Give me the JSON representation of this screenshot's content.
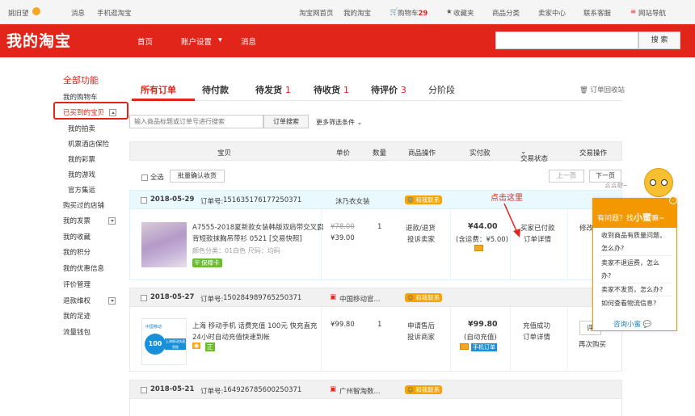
{
  "topbar": {
    "user": "姚旧望",
    "messages": "消息",
    "mobile": "手机逛淘宝",
    "home": "淘宝网首页",
    "mytaobao": "我的淘宝",
    "cart": "购物车",
    "cart_count": "29",
    "fav": "收藏夹",
    "category": "商品分类",
    "seller": "卖家中心",
    "service": "联系客服",
    "sitenav": "网站导航"
  },
  "header": {
    "logo": "我的淘宝",
    "nav": [
      "首页",
      "账户设置",
      "消息"
    ],
    "search_button": "搜 索"
  },
  "sidebar": {
    "title": "全部功能",
    "items": [
      "我的购物车",
      "已买到的宝贝",
      "我的拍卖",
      "机票酒店保险",
      "我的彩票",
      "我的游戏",
      "官方集运",
      "购买过的店铺",
      "我的发票",
      "我的收藏",
      "我的积分",
      "我的优惠信息",
      "评价管理",
      "退款维权",
      "我的足迹",
      "流量钱包"
    ]
  },
  "tabs": [
    {
      "label": "所有订单",
      "count": ""
    },
    {
      "label": "待付款",
      "count": ""
    },
    {
      "label": "待发货",
      "count": "1"
    },
    {
      "label": "待收货",
      "count": "1"
    },
    {
      "label": "待评价",
      "count": "3"
    },
    {
      "label": "分阶段",
      "count": ""
    }
  ],
  "recycle": "订单回收站",
  "filter": {
    "placeholder": "输入商品标题或订单号进行搜索",
    "button": "订单搜索",
    "more": "更多筛选条件"
  },
  "columns": [
    "宝贝",
    "单价",
    "数量",
    "商品操作",
    "实付款",
    "交易状态",
    "交易操作"
  ],
  "bulk": {
    "select_all": "全选",
    "confirm": "批量确认收货",
    "prev": "上一页",
    "next": "下一页"
  },
  "orders": [
    {
      "date": "2018-05-29",
      "no_label": "订单号:",
      "no": "151635176177250371",
      "shop": "沐乃衣女装",
      "contact": "和我联系",
      "title1": "A7555-2018夏新款女装韩版双肩带交叉露",
      "title2": "背短款抹胸吊带衫 0521 [交易快照]",
      "spec": "颜色分类：01白色  尺码：均码",
      "badge": "保障卡",
      "orig": "¥78.00",
      "price": "¥39.00",
      "qty": "1",
      "op1": "退款/退货",
      "op2": "投诉卖家",
      "paid": "¥44.00",
      "freight": "(含运费：¥5.00)",
      "status1": "买家已付款",
      "status2": "订单详情",
      "action": "修改"
    },
    {
      "date": "2018-05-27",
      "no_label": "订单号:",
      "no": "150284989765250371",
      "shop": "中国移动官...",
      "contact": "和我联系",
      "title1": "上海 移动手机 话费充值 100元 快充直充",
      "title2": "24小时自动充值快速到帐",
      "badge": "正",
      "price": "¥99.80",
      "qty": "1",
      "op1": "申请售后",
      "op2": "投诉商家",
      "paid": "¥99.80",
      "freight": "(自动充值)",
      "phonetag": "手机订单",
      "status1": "充值成功",
      "status2": "订单详情",
      "action": "评",
      "action2": "再次购买",
      "card_amount": "100",
      "card_brand": "中国移动",
      "card_text": "上海移动快速到账"
    },
    {
      "date": "2018-05-21",
      "no_label": "订单号:",
      "no": "164926785600250371",
      "shop": "广州智淘数...",
      "contact": "和我联系"
    }
  ],
  "annotation": "点击这里",
  "helper": {
    "head": "有问题？找",
    "name": "小蜜",
    "tail": "嘛~",
    "bubble": "么么哒~",
    "questions": [
      "收到商品有质量问题，",
      "怎么办?",
      "卖家不退运费，怎么",
      "办?",
      "卖家不发货，怎么办?",
      "如何查看物流信息?"
    ],
    "link": "咨询小蜜"
  }
}
